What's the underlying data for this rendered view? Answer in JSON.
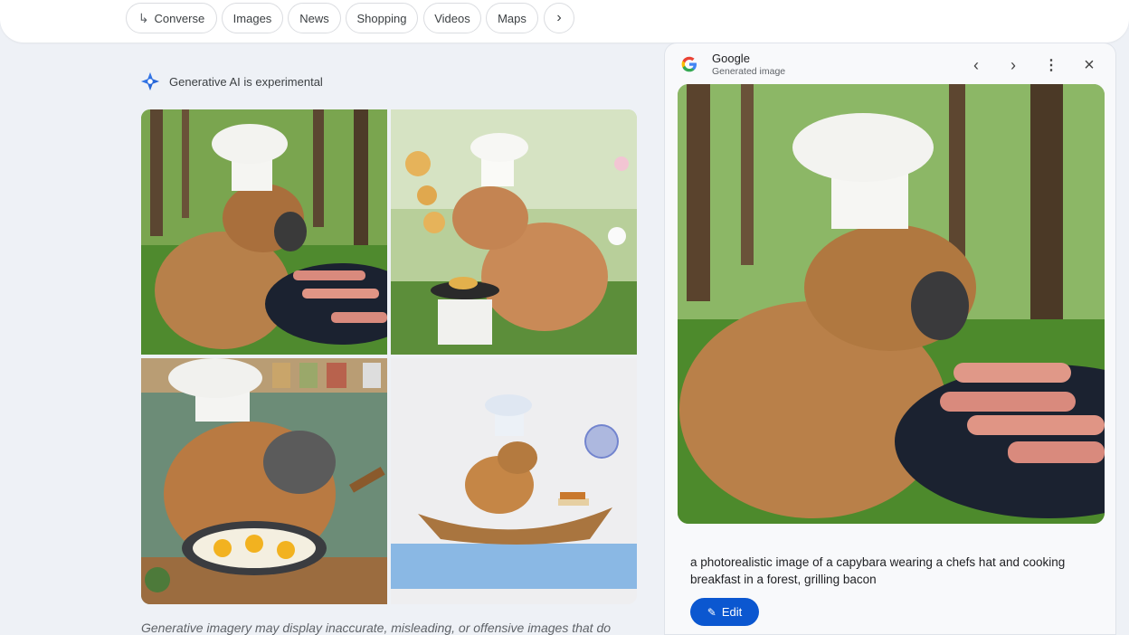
{
  "nav": {
    "chips": [
      {
        "label": "Converse",
        "icon": "arrow-return-icon"
      },
      {
        "label": "Images"
      },
      {
        "label": "News"
      },
      {
        "label": "Shopping"
      },
      {
        "label": "Videos"
      },
      {
        "label": "Maps"
      }
    ],
    "more_icon": "chevron-right-icon"
  },
  "ai_notice": "Generative AI is experimental",
  "images": [
    {
      "subject": "capybara chef grilling bacon in forest"
    },
    {
      "subject": "capybara chef cooking pancakes outdoors"
    },
    {
      "subject": "capybara chef frying eggs in kitchen"
    },
    {
      "subject": "capybara chef in a boat watercolor"
    }
  ],
  "disclaimer": "Generative imagery may display inaccurate, misleading, or offensive images that do",
  "panel": {
    "source_title": "Google",
    "source_subtitle": "Generated image",
    "prompt": "a photorealistic image of a capybara wearing a chefs hat and cooking breakfast in a forest, grilling bacon",
    "edit_label": "Edit"
  },
  "colors": {
    "accent": "#0b57d0",
    "page_bg": "#eef1f6"
  }
}
